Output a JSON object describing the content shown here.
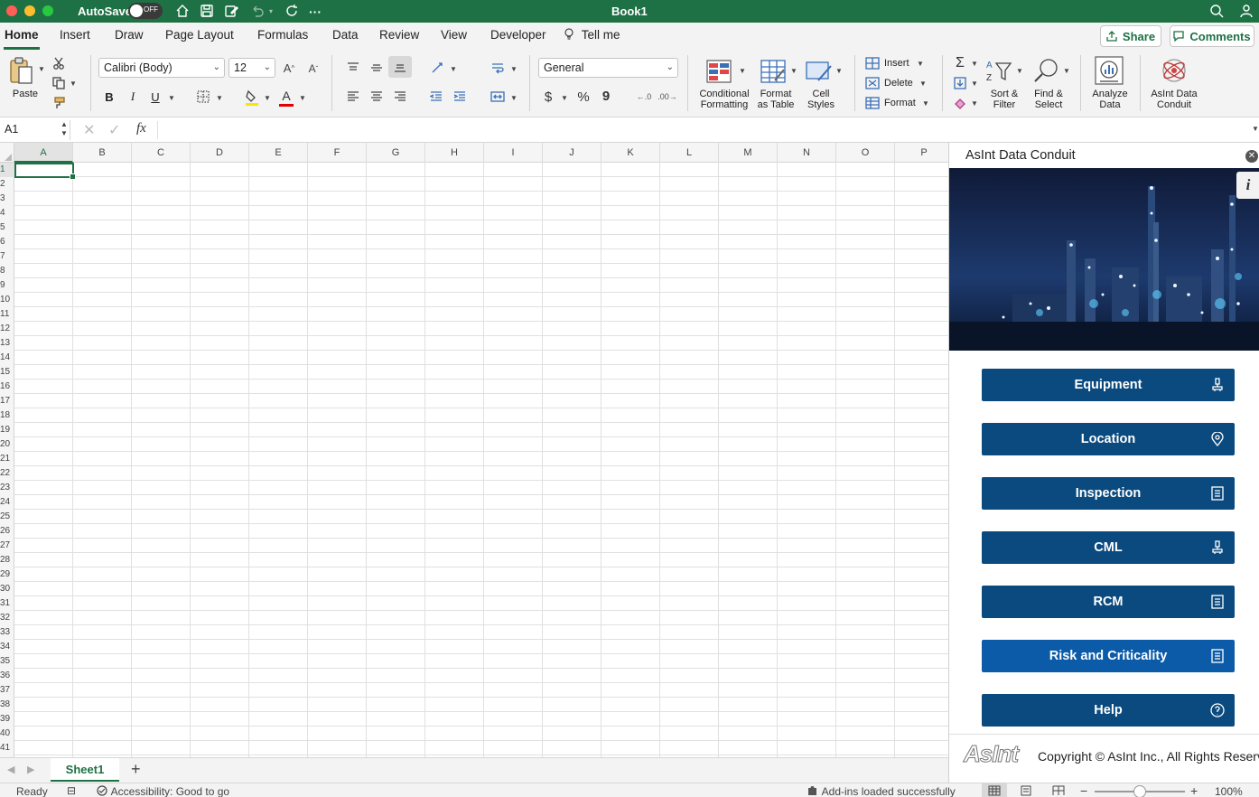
{
  "app": {
    "title": "Book1",
    "autosave_label": "AutoSave",
    "autosave_state": "OFF",
    "colors": {
      "accent": "#1e7145",
      "pane_button": "#0b4a7f",
      "pane_button_alt": "#0b5ba8"
    }
  },
  "tabs": [
    "Home",
    "Insert",
    "Draw",
    "Page Layout",
    "Formulas",
    "Data",
    "Review",
    "View",
    "Developer"
  ],
  "tell_me": "Tell me",
  "header_buttons": {
    "share": "Share",
    "comments": "Comments"
  },
  "ribbon": {
    "paste_label": "Paste",
    "font_name": "Calibri (Body)",
    "font_size": "12",
    "bold": "B",
    "italic": "I",
    "underline": "U",
    "number_format": "General",
    "currency": "$",
    "percent": "%",
    "comma": "9",
    "conditional_formatting": [
      "Conditional",
      "Formatting"
    ],
    "format_as_table": [
      "Format",
      "as Table"
    ],
    "cell_styles": [
      "Cell",
      "Styles"
    ],
    "cells_insert": "Insert",
    "cells_delete": "Delete",
    "cells_format": "Format",
    "sort_filter": [
      "Sort &",
      "Filter"
    ],
    "find_select": [
      "Find &",
      "Select"
    ],
    "analyze_data": [
      "Analyze",
      "Data"
    ],
    "asint_conduit": [
      "AsInt Data",
      "Conduit"
    ]
  },
  "formula_bar": {
    "name_box": "A1",
    "fx": "fx",
    "value": ""
  },
  "grid": {
    "columns": [
      "A",
      "B",
      "C",
      "D",
      "E",
      "F",
      "G",
      "H",
      "I",
      "J",
      "K",
      "L",
      "M",
      "N",
      "O",
      "P"
    ],
    "rows": [
      "1",
      "2",
      "3",
      "4",
      "5",
      "6",
      "7",
      "8",
      "9",
      "10",
      "11",
      "12",
      "13",
      "14",
      "15",
      "16",
      "17",
      "18",
      "19",
      "20",
      "21",
      "22",
      "23",
      "24",
      "25",
      "26",
      "27",
      "28",
      "29",
      "30",
      "31",
      "32",
      "33",
      "34",
      "35",
      "36",
      "37",
      "38",
      "39",
      "40",
      "41"
    ],
    "selected_cell": "A1"
  },
  "sheets": {
    "active": "Sheet1",
    "add": "+"
  },
  "status": {
    "ready": "Ready",
    "accessibility": "Accessibility: Good to go",
    "addins": "Add-ins loaded successfully",
    "zoom_minus": "−",
    "zoom_plus": "+",
    "zoom": "100%"
  },
  "pane": {
    "title": "AsInt Data Conduit",
    "info": "i",
    "buttons": [
      {
        "label": "Equipment",
        "icon": "equipment-icon"
      },
      {
        "label": "Location",
        "icon": "location-pin-icon"
      },
      {
        "label": "Inspection",
        "icon": "checklist-icon"
      },
      {
        "label": "CML",
        "icon": "equipment-icon"
      },
      {
        "label": "RCM",
        "icon": "checklist-icon"
      },
      {
        "label": "Risk and Criticality",
        "icon": "checklist-icon"
      },
      {
        "label": "Help",
        "icon": "help-icon"
      }
    ],
    "footer_logo": "AsInt",
    "copyright": "Copyright © AsInt Inc., All Rights Reserved"
  }
}
